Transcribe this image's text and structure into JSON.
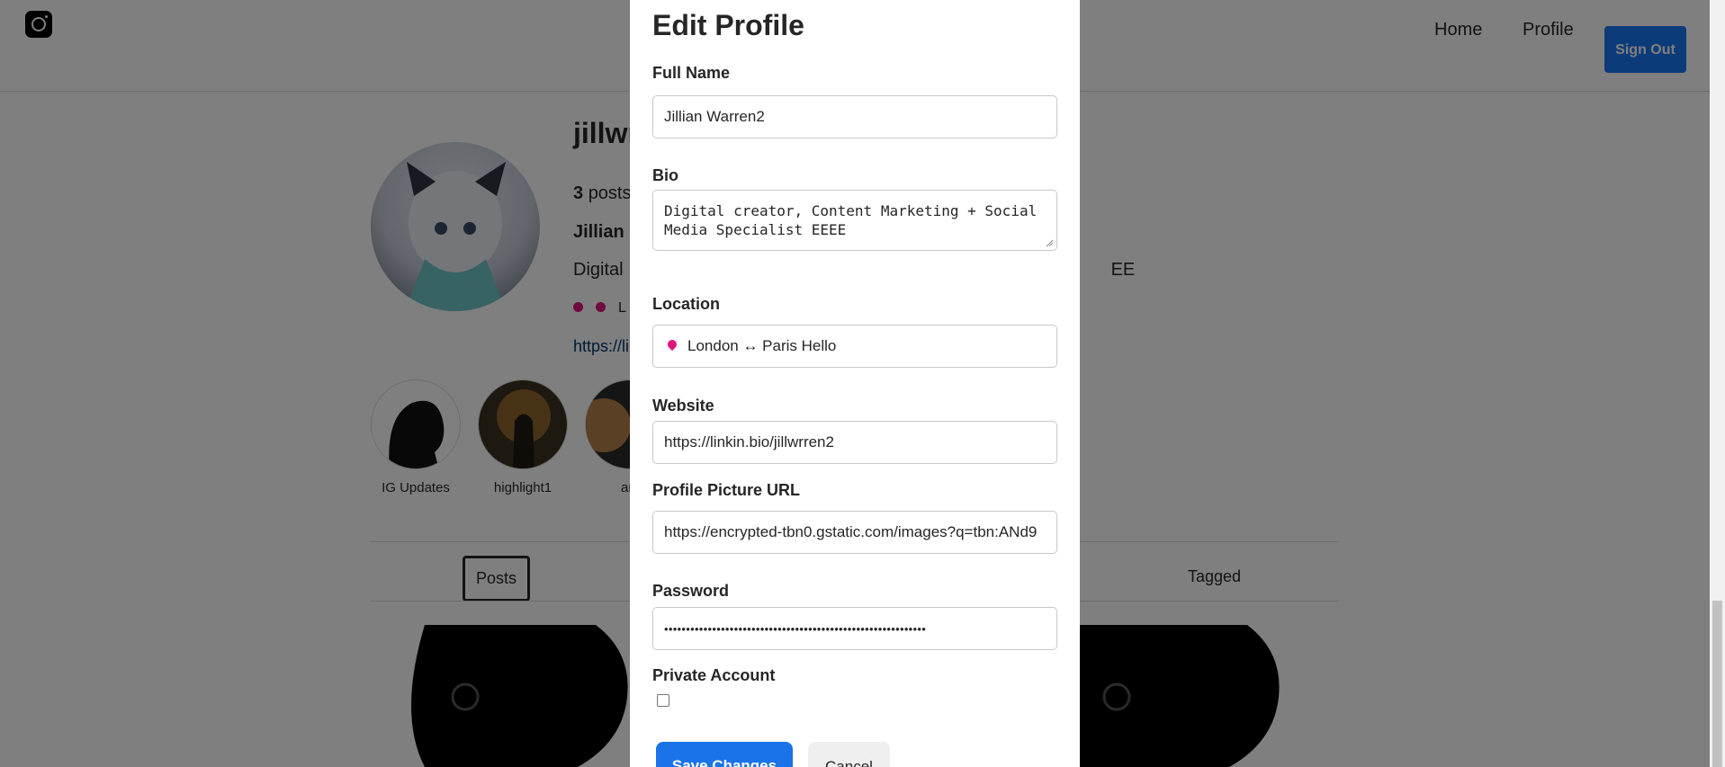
{
  "nav": {
    "logo_icon": "instagram-icon",
    "home": "Home",
    "profile": "Profile",
    "sign_out": "Sign Out"
  },
  "background_profile": {
    "username_partial": "jillwr",
    "posts_count": "3",
    "posts_label": "posts",
    "fullname_partial": "Jillian",
    "bio_start": "Digital",
    "bio_end": "EE",
    "location_partial": "L",
    "url_partial": "https://lin",
    "highlights": [
      {
        "label": "IG Updates"
      },
      {
        "label": "highlight1"
      },
      {
        "label": "ani"
      }
    ],
    "tabs": {
      "posts": "Posts",
      "tagged": "Tagged"
    }
  },
  "modal": {
    "title": "Edit Profile",
    "fullname": {
      "label": "Full Name",
      "value": "Jillian Warren2"
    },
    "bio": {
      "label": "Bio",
      "value": "Digital creator, Content Marketing + Social Media Specialist EEEE"
    },
    "location": {
      "label": "Location",
      "value": "London ↔ Paris Hello"
    },
    "website": {
      "label": "Website",
      "value": "https://linkin.bio/jillwrren2"
    },
    "picture_url": {
      "label": "Profile Picture URL",
      "value": "https://encrypted-tbn0.gstatic.com/images?q=tbn:ANd9"
    },
    "password": {
      "label": "Password",
      "value": "••••••••••••••••••••••••••••••••••••••••••••••••••••••••••••"
    },
    "private": {
      "label": "Private Account",
      "checked": false
    },
    "save": "Save Changes",
    "cancel": "Cancel"
  },
  "colors": {
    "accent": "#1a73e8",
    "overlay": "rgba(0,0,0,0.5)",
    "pin": "#e0147f"
  }
}
